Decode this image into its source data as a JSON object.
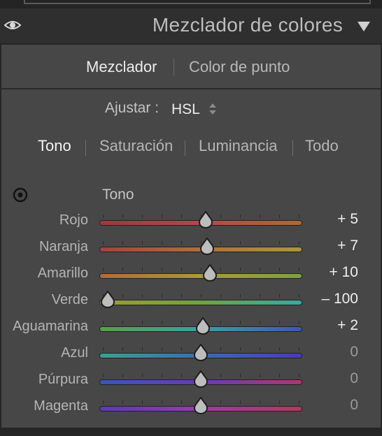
{
  "panel": {
    "title": "Mezclador de colores",
    "visibility_icon": "eye-icon",
    "collapse_icon": "triangle-down-icon"
  },
  "modes": {
    "items": [
      {
        "label": "Mezclador",
        "active": true
      },
      {
        "label": "Color de punto",
        "active": false
      }
    ]
  },
  "adjust": {
    "label": "Ajustar :",
    "value": "HSL",
    "stepper_icon": "up-down-arrows-icon"
  },
  "subtabs": {
    "items": [
      {
        "label": "Tono",
        "active": true
      },
      {
        "label": "Saturación",
        "active": false
      },
      {
        "label": "Luminancia",
        "active": false
      },
      {
        "label": "Todo",
        "active": false
      }
    ]
  },
  "section": {
    "title": "Tono",
    "target_icon": "target-adjust-icon"
  },
  "sliders": [
    {
      "label": "Rojo",
      "value": 5,
      "display": "+ 5",
      "colors": [
        "#9a3a3a",
        "#b04a4a",
        "#a86a3a"
      ]
    },
    {
      "label": "Naranja",
      "value": 7,
      "display": "+ 7",
      "colors": [
        "#a84040",
        "#b07038",
        "#a89838"
      ]
    },
    {
      "label": "Amarillo",
      "value": 10,
      "display": "+ 10",
      "colors": [
        "#b06a38",
        "#a89838",
        "#7ea040"
      ]
    },
    {
      "label": "Verde",
      "value": -100,
      "display": "– 100",
      "colors": [
        "#9c9a3a",
        "#6fa244",
        "#3aa8a0"
      ]
    },
    {
      "label": "Aguamarina",
      "value": 2,
      "display": "+ 2",
      "colors": [
        "#58a04a",
        "#3aa0a0",
        "#3e56b8"
      ]
    },
    {
      "label": "Azul",
      "value": 0,
      "display": "0",
      "colors": [
        "#3aa08c",
        "#3a6cb0",
        "#4a3ab8"
      ]
    },
    {
      "label": "Púrpura",
      "value": 0,
      "display": "0",
      "colors": [
        "#3a56b8",
        "#6a3ab0",
        "#a83a70"
      ]
    },
    {
      "label": "Magenta",
      "value": 0,
      "display": "0",
      "colors": [
        "#5a3ab8",
        "#9a3aa8",
        "#b03a5a"
      ]
    }
  ],
  "slider_range": [
    -100,
    100
  ]
}
